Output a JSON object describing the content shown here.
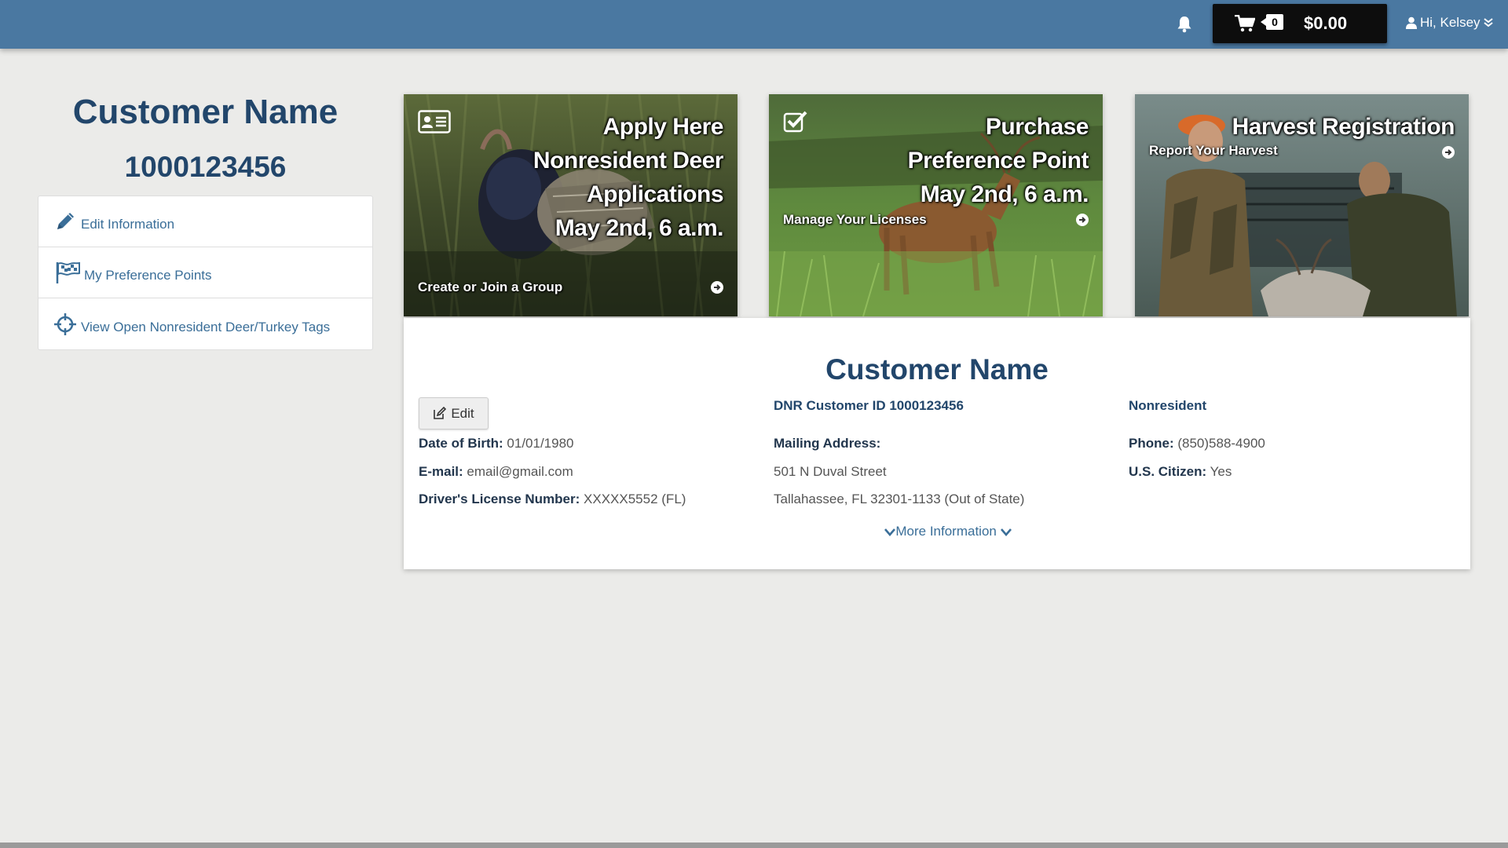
{
  "topbar": {
    "cart_count": "0",
    "cart_total": "$0.00",
    "user_greeting": "Hi, Kelsey"
  },
  "sidebar": {
    "customer_name": "Customer Name",
    "customer_id": "1000123456",
    "items": [
      {
        "label": "Edit Information",
        "icon": "pencil-icon"
      },
      {
        "label": "My Preference Points",
        "icon": "flag-icon"
      },
      {
        "label": "View Open Nonresident Deer/Turkey Tags",
        "icon": "crosshair-icon"
      }
    ]
  },
  "tiles": [
    {
      "title_lines": [
        "Apply Here",
        "Nonresident Deer",
        "Applications",
        "May 2nd, 6 a.m."
      ],
      "link": "Create or Join a Group",
      "icon": "id-card-icon"
    },
    {
      "title_lines": [
        "Purchase",
        "Preference Point",
        "May 2nd, 6 a.m."
      ],
      "link": "Manage Your Licenses",
      "icon": "checkbox-icon"
    },
    {
      "title_lines": [
        "Harvest Registration"
      ],
      "link": "Report Your Harvest"
    }
  ],
  "customer_card": {
    "title": "Customer Name",
    "edit_label": "Edit",
    "dnr_label": "DNR Customer ID 1000123456",
    "residency": "Nonresident",
    "dob_label": "Date of Birth:",
    "dob_value": "01/01/1980",
    "email_label": "E-mail:",
    "email_value": "email@gmail.com",
    "dl_label": "Driver's License Number:",
    "dl_value": "XXXXX5552 (FL)",
    "mailing_label": "Mailing Address:",
    "address_line1": "501 N Duval Street",
    "address_line2": "Tallahassee, FL 32301-1133 (Out of State)",
    "phone_label": "Phone:",
    "phone_value": "(850)588-4900",
    "citizen_label": "U.S. Citizen:",
    "citizen_value": "Yes",
    "more_info": "More Information"
  },
  "colors": {
    "topbar": "#4a78a1",
    "heading": "#22466b",
    "link": "#3a6e98",
    "background": "#ebebe9"
  }
}
